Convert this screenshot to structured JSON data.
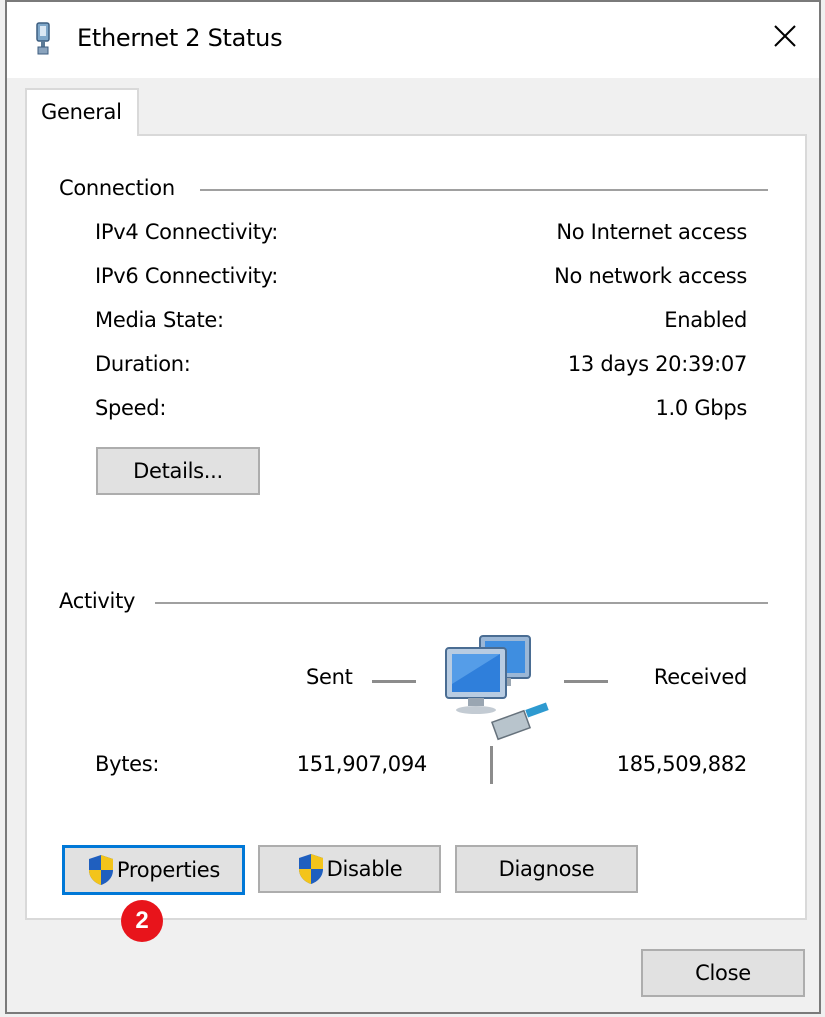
{
  "window": {
    "title": "Ethernet 2 Status",
    "close_icon": "close-icon"
  },
  "tabs": [
    {
      "label": "General",
      "selected": true
    }
  ],
  "connection": {
    "group_label": "Connection",
    "rows": [
      {
        "label": "IPv4 Connectivity:",
        "value": "No Internet access"
      },
      {
        "label": "IPv6 Connectivity:",
        "value": "No network access"
      },
      {
        "label": "Media State:",
        "value": "Enabled"
      },
      {
        "label": "Duration:",
        "value": "13 days 20:39:07"
      },
      {
        "label": "Speed:",
        "value": "1.0 Gbps"
      }
    ],
    "details_button": "Details..."
  },
  "activity": {
    "group_label": "Activity",
    "sent_label": "Sent",
    "received_label": "Received",
    "bytes_label": "Bytes:",
    "bytes_sent": "151,907,094",
    "bytes_received": "185,509,882",
    "network_icon": "network-computers-icon"
  },
  "buttons": {
    "properties": "Properties",
    "disable": "Disable",
    "diagnose": "Diagnose",
    "close": "Close"
  },
  "annotation": {
    "step_number": "2",
    "color": "#e8141b"
  },
  "colors": {
    "focus": "#0078d7",
    "shield_blue": "#1f5fbf",
    "shield_yellow": "#f3c41b"
  }
}
